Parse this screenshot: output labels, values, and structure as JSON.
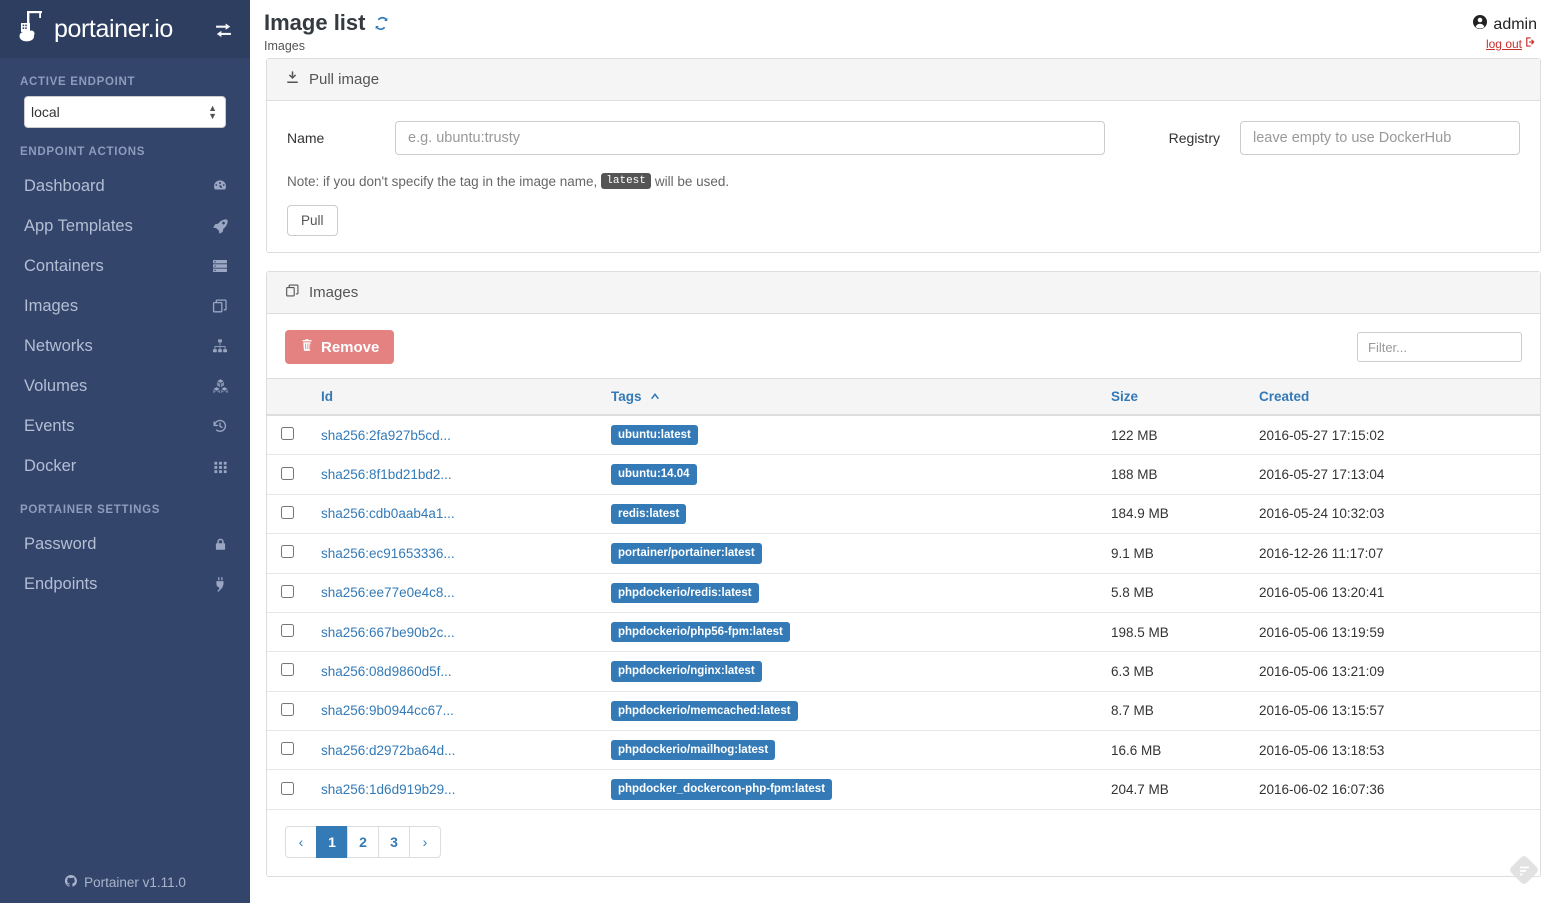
{
  "brand": {
    "name": "portainer.io",
    "toggle_icon": "exchange-arrows-icon",
    "logo_icon": "portainer-whale-crane-logo"
  },
  "sidebar": {
    "sections": [
      {
        "heading": "ACTIVE ENDPOINT"
      },
      {
        "heading": "ENDPOINT ACTIONS"
      },
      {
        "heading": "PORTAINER SETTINGS"
      }
    ],
    "endpoint_select": {
      "value": "local",
      "options": [
        "local"
      ]
    },
    "endpoint_actions": [
      {
        "label": "Dashboard",
        "icon": "tachometer-icon"
      },
      {
        "label": "App Templates",
        "icon": "rocket-icon"
      },
      {
        "label": "Containers",
        "icon": "server-icon"
      },
      {
        "label": "Images",
        "icon": "clone-icon"
      },
      {
        "label": "Networks",
        "icon": "sitemap-icon"
      },
      {
        "label": "Volumes",
        "icon": "cubes-icon"
      },
      {
        "label": "Events",
        "icon": "history-icon"
      },
      {
        "label": "Docker",
        "icon": "th-grid-icon"
      }
    ],
    "portainer_settings": [
      {
        "label": "Password",
        "icon": "lock-icon"
      },
      {
        "label": "Endpoints",
        "icon": "plug-icon"
      }
    ],
    "footer": {
      "icon": "github-icon",
      "label": "Portainer v1.11.0"
    }
  },
  "header": {
    "title": "Image list",
    "refresh_icon": "refresh-icon",
    "breadcrumb": "Images",
    "user": {
      "avatar_icon": "user-circle-icon",
      "name": "admin",
      "logout_label": "log out",
      "logout_icon": "sign-out-icon"
    }
  },
  "pull_panel": {
    "icon": "download-icon",
    "title": "Pull image",
    "name_label": "Name",
    "name_placeholder": "e.g. ubuntu:trusty",
    "name_value": "",
    "registry_label": "Registry",
    "registry_placeholder": "leave empty to use DockerHub",
    "registry_value": "",
    "note_prefix": "Note: if you don't specify the tag in the image name,",
    "note_code": "latest",
    "note_suffix": "will be used.",
    "pull_button": "Pull"
  },
  "images_panel": {
    "icon": "clone-icon",
    "title": "Images",
    "remove_button": "Remove",
    "remove_icon": "trash-icon",
    "remove_color": "#e48181",
    "filter_placeholder": "Filter...",
    "columns": [
      {
        "key": "id",
        "label": "Id",
        "sorted": false
      },
      {
        "key": "tags",
        "label": "Tags",
        "sorted": true,
        "sort_icon": "caret-up-icon"
      },
      {
        "key": "size",
        "label": "Size",
        "sorted": false
      },
      {
        "key": "created",
        "label": "Created",
        "sorted": false
      }
    ],
    "accent_color": "#337ab7",
    "rows": [
      {
        "checked": false,
        "id": "sha256:2fa927b5cd...",
        "tags": [
          "ubuntu:latest"
        ],
        "size": "122 MB",
        "created": "2016-05-27 17:15:02"
      },
      {
        "checked": false,
        "id": "sha256:8f1bd21bd2...",
        "tags": [
          "ubuntu:14.04"
        ],
        "size": "188 MB",
        "created": "2016-05-27 17:13:04"
      },
      {
        "checked": false,
        "id": "sha256:cdb0aab4a1...",
        "tags": [
          "redis:latest"
        ],
        "size": "184.9 MB",
        "created": "2016-05-24 10:32:03"
      },
      {
        "checked": false,
        "id": "sha256:ec91653336...",
        "tags": [
          "portainer/portainer:latest"
        ],
        "size": "9.1 MB",
        "created": "2016-12-26 11:17:07"
      },
      {
        "checked": false,
        "id": "sha256:ee77e0e4c8...",
        "tags": [
          "phpdockerio/redis:latest"
        ],
        "size": "5.8 MB",
        "created": "2016-05-06 13:20:41"
      },
      {
        "checked": false,
        "id": "sha256:667be90b2c...",
        "tags": [
          "phpdockerio/php56-fpm:latest"
        ],
        "size": "198.5 MB",
        "created": "2016-05-06 13:19:59"
      },
      {
        "checked": false,
        "id": "sha256:08d9860d5f...",
        "tags": [
          "phpdockerio/nginx:latest"
        ],
        "size": "6.3 MB",
        "created": "2016-05-06 13:21:09"
      },
      {
        "checked": false,
        "id": "sha256:9b0944cc67...",
        "tags": [
          "phpdockerio/memcached:latest"
        ],
        "size": "8.7 MB",
        "created": "2016-05-06 13:15:57"
      },
      {
        "checked": false,
        "id": "sha256:d2972ba64d...",
        "tags": [
          "phpdockerio/mailhog:latest"
        ],
        "size": "16.6 MB",
        "created": "2016-05-06 13:18:53"
      },
      {
        "checked": false,
        "id": "sha256:1d6d919b29...",
        "tags": [
          "phpdocker_dockercon-php-fpm:latest"
        ],
        "size": "204.7 MB",
        "created": "2016-06-02 16:07:36"
      }
    ],
    "pagination": {
      "prev": "‹",
      "next": "›",
      "pages": [
        "1",
        "2",
        "3"
      ],
      "current": "1"
    }
  },
  "watermark": {
    "icon": "tag-watermark-icon"
  }
}
